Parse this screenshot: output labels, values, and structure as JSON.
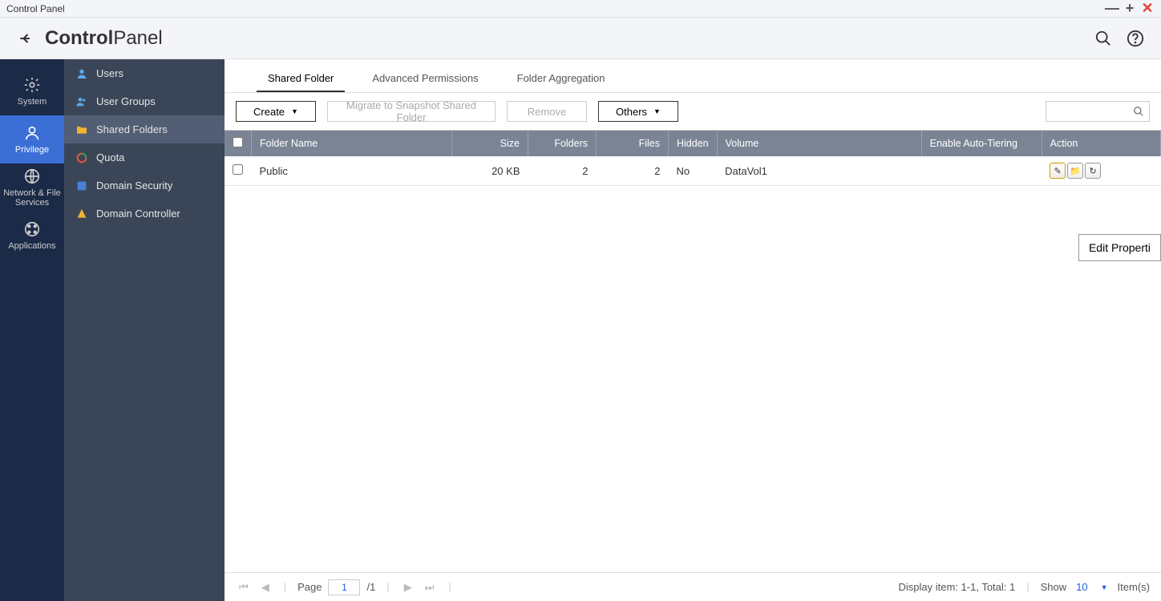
{
  "window_title": "Control Panel",
  "header": {
    "title_bold": "Control",
    "title_light": "Panel"
  },
  "nav": [
    {
      "label": "System"
    },
    {
      "label": "Privilege"
    },
    {
      "label": "Network & File Services"
    },
    {
      "label": "Applications"
    }
  ],
  "sidebar": {
    "items": [
      {
        "label": "Users"
      },
      {
        "label": "User Groups"
      },
      {
        "label": "Shared Folders"
      },
      {
        "label": "Quota"
      },
      {
        "label": "Domain Security"
      },
      {
        "label": "Domain Controller"
      }
    ]
  },
  "tabs": [
    {
      "label": "Shared Folder"
    },
    {
      "label": "Advanced Permissions"
    },
    {
      "label": "Folder Aggregation"
    }
  ],
  "toolbar": {
    "create": "Create",
    "migrate": "Migrate to Snapshot Shared Folder",
    "remove": "Remove",
    "others": "Others"
  },
  "table": {
    "columns": {
      "folder_name": "Folder Name",
      "size": "Size",
      "folders": "Folders",
      "files": "Files",
      "hidden": "Hidden",
      "volume": "Volume",
      "auto_tiering": "Enable Auto-Tiering",
      "action": "Action"
    },
    "rows": [
      {
        "name": "Public",
        "size": "20 KB",
        "folders": "2",
        "files": "2",
        "hidden": "No",
        "volume": "DataVol1"
      }
    ]
  },
  "float_button": "Edit Properti",
  "footer": {
    "page_label": "Page",
    "page_current": "1",
    "page_total": "/1",
    "display": "Display item: 1-1, Total: 1",
    "show_label": "Show",
    "show_count": "10",
    "items": "Item(s)"
  }
}
